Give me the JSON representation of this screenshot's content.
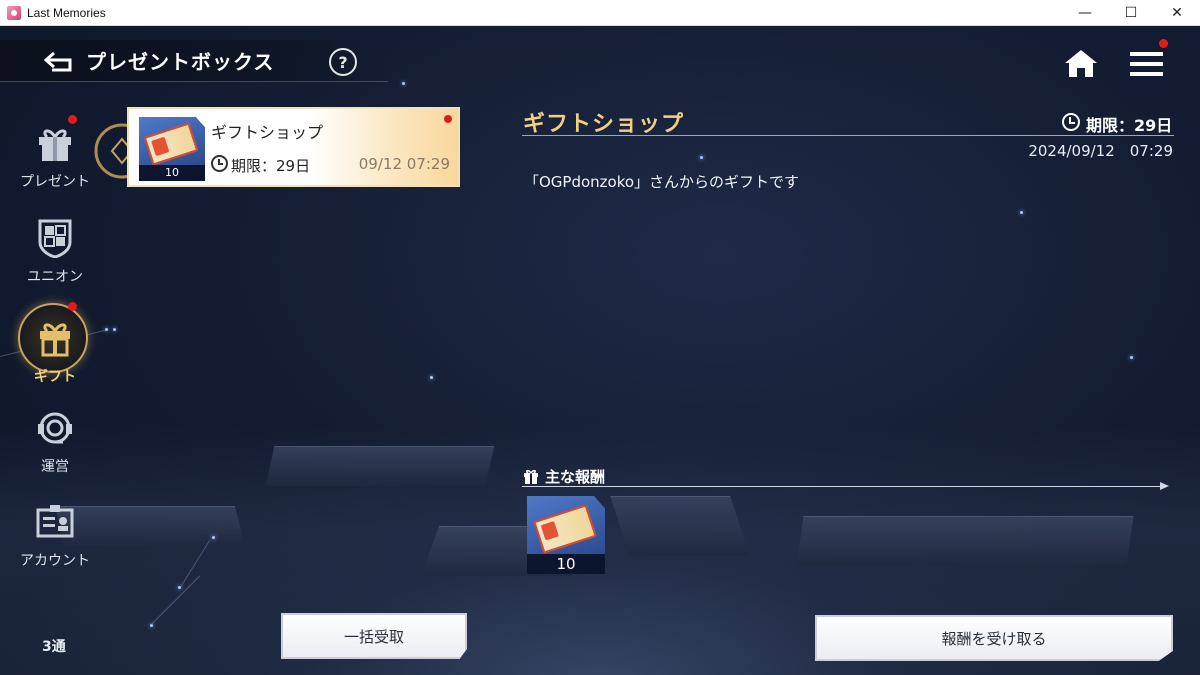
{
  "window": {
    "title": "Last Memories",
    "minimize": "—",
    "maximize": "☐",
    "close": "✕"
  },
  "header": {
    "title": "プレゼントボックス",
    "help_label": "?"
  },
  "sidebar": {
    "items": [
      {
        "label": "プレゼント",
        "icon": "gift-box-icon",
        "badge": true
      },
      {
        "label": "ユニオン",
        "icon": "shield-icon",
        "badge": false
      },
      {
        "label": "ギフト",
        "icon": "gift-icon",
        "badge": true,
        "active": true
      },
      {
        "label": "運営",
        "icon": "support-icon",
        "badge": false
      },
      {
        "label": "アカウント",
        "icon": "id-card-icon",
        "badge": false
      }
    ],
    "count": "3通"
  },
  "list": {
    "items": [
      {
        "title": "ギフトショップ",
        "quantity": "10",
        "limit": "期限：29日",
        "date": "09/12  07:29",
        "unread": true
      }
    ]
  },
  "detail": {
    "title": "ギフトショップ",
    "limit": "期限：29日",
    "datetime": "2024/09/12　07:29",
    "message": "「OGPdonzoko」さんからのギフトです",
    "rewards_label": "主な報酬",
    "rewards": [
      {
        "quantity": "10",
        "icon": "ticket-icon"
      }
    ]
  },
  "buttons": {
    "bulk_receive": "一括受取",
    "receive": "報酬を受け取る"
  },
  "colors": {
    "accent_gold": "#f4cf80",
    "badge_red": "#e01b1b",
    "background": "#141d33"
  }
}
